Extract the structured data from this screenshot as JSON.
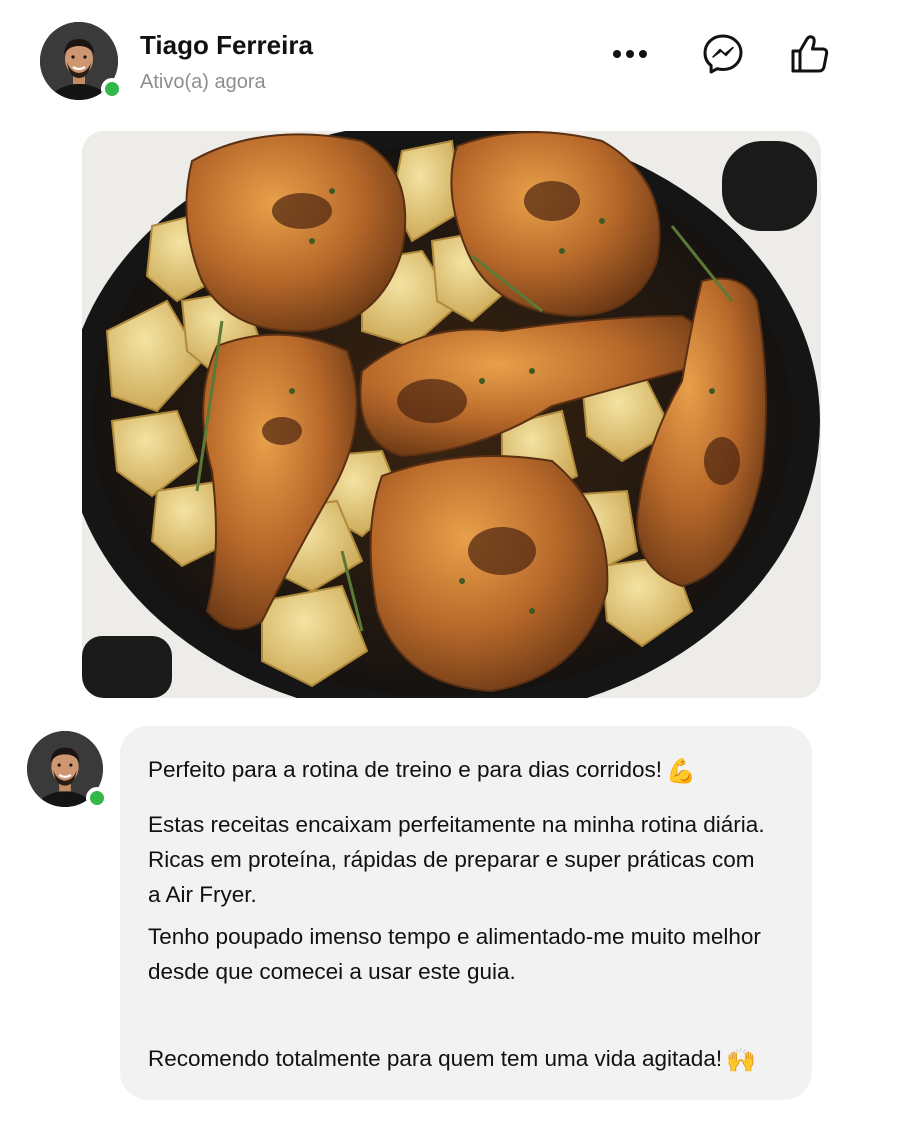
{
  "header": {
    "name": "Tiago Ferreira",
    "status": "Ativo(a) agora",
    "more_icon": "more-horizontal-icon",
    "messenger_icon": "messenger-icon",
    "like_icon": "thumbs-up-icon",
    "online_color": "#35b84a"
  },
  "photo": {
    "subject": "roasted-chicken-with-potatoes-in-skillet"
  },
  "message": {
    "line1": "Perfeito para a rotina de treino e para dias corridos!",
    "line1_emoji": "💪",
    "paragraph2": "Estas receitas encaixam perfeitamente na minha rotina diária. Ricas em proteína, rápidas de preparar e super práticas com a Air Fryer.",
    "paragraph3": "Tenho poupado imenso tempo e alimentado-me muito melhor desde que comecei a usar este guia.",
    "line4": "Recomendo totalmente para quem tem uma vida agitada!",
    "line4_emoji": "🙌",
    "bubble_color": "#f2f2f2"
  }
}
